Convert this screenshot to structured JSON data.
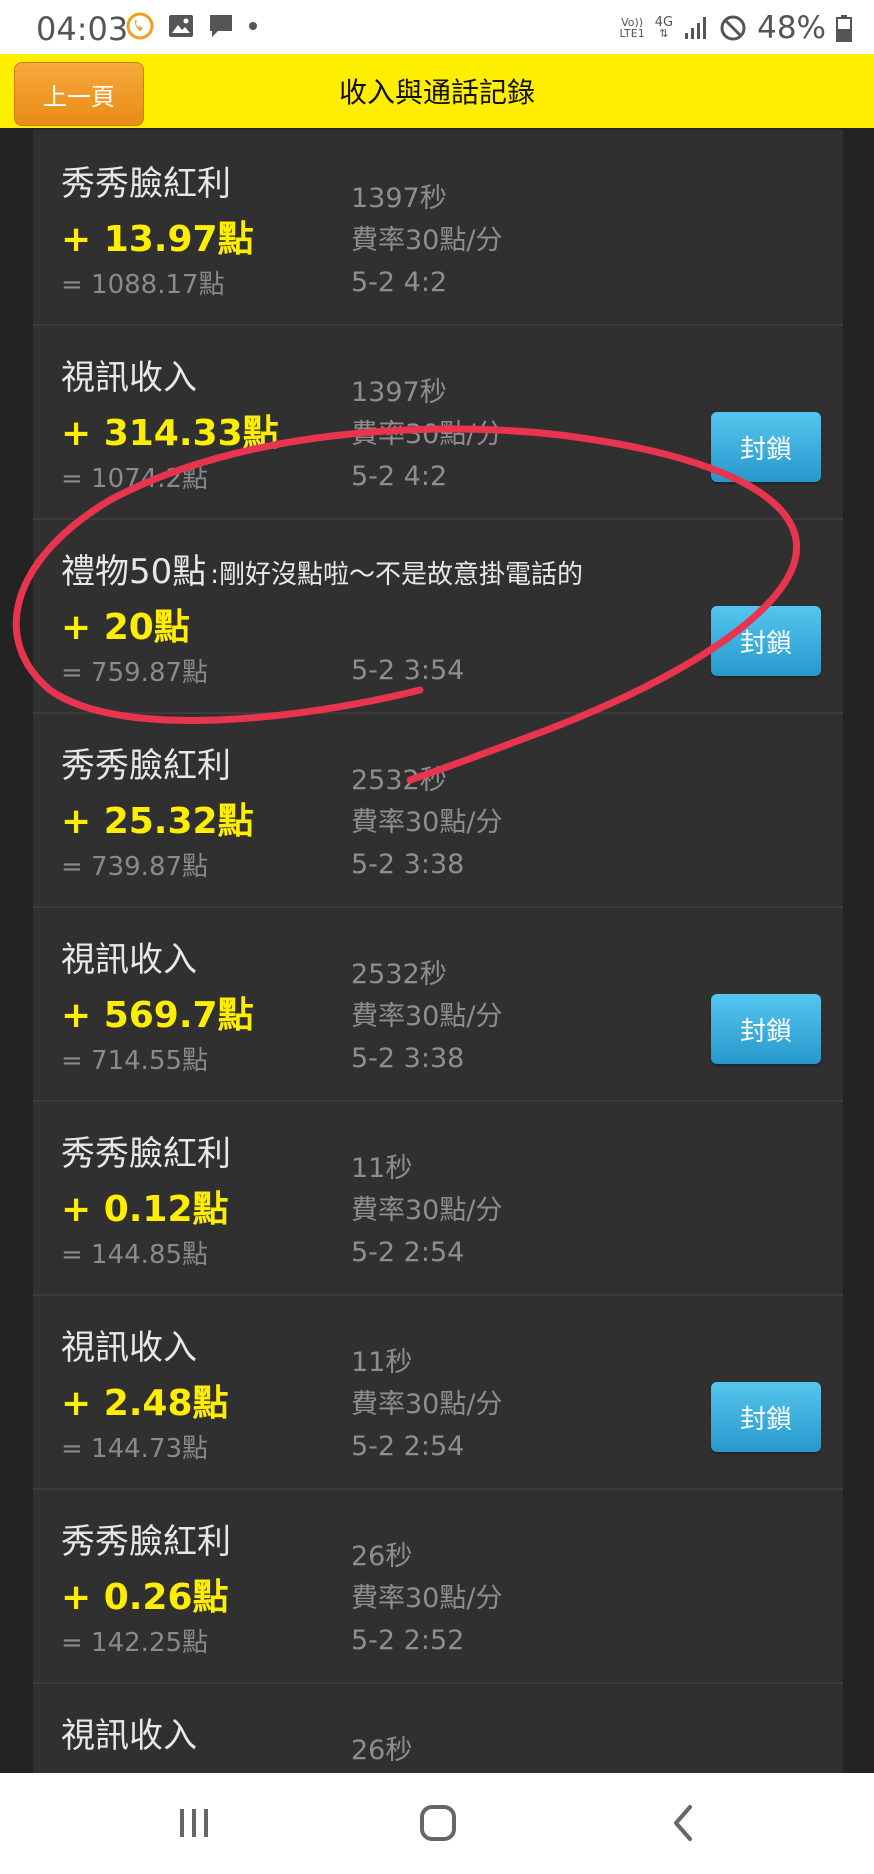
{
  "status_bar": {
    "time": "04:03",
    "left_icons": [
      "phone-call-icon",
      "image-icon",
      "message-icon",
      "dot-icon"
    ],
    "network_label_top": "Vo))",
    "network_label_bottom": "LTE1",
    "network_type": "4G",
    "battery_percent": "48%"
  },
  "header": {
    "back_label": "上一頁",
    "title": "收入與通話記錄",
    "background_color": "#ffee00"
  },
  "records": [
    {
      "title": "秀秀臉紅利",
      "amount": "+ 13.97點",
      "balance": "= 1088.17點",
      "info": [
        "1397秒",
        "費率30點/分",
        "5-2 4:2"
      ],
      "block": false
    },
    {
      "title": "視訊收入",
      "amount": "+ 314.33點",
      "balance": "= 1074.2點",
      "info": [
        "1397秒",
        "費率30點/分",
        "5-2 4:2"
      ],
      "block": true
    },
    {
      "title": "禮物50點",
      "message": ":剛好沒點啦～不是故意掛電話的",
      "amount": "+ 20點",
      "balance": "= 759.87點",
      "info": [
        "",
        "",
        "5-2 3:54"
      ],
      "block": true
    },
    {
      "title": "秀秀臉紅利",
      "amount": "+ 25.32點",
      "balance": "= 739.87點",
      "info": [
        "2532秒",
        "費率30點/分",
        "5-2 3:38"
      ],
      "block": false
    },
    {
      "title": "視訊收入",
      "amount": "+ 569.7點",
      "balance": "= 714.55點",
      "info": [
        "2532秒",
        "費率30點/分",
        "5-2 3:38"
      ],
      "block": true
    },
    {
      "title": "秀秀臉紅利",
      "amount": "+ 0.12點",
      "balance": "= 144.85點",
      "info": [
        "11秒",
        "費率30點/分",
        "5-2 2:54"
      ],
      "block": false
    },
    {
      "title": "視訊收入",
      "amount": "+ 2.48點",
      "balance": "= 144.73點",
      "info": [
        "11秒",
        "費率30點/分",
        "5-2 2:54"
      ],
      "block": true
    },
    {
      "title": "秀秀臉紅利",
      "amount": "+ 0.26點",
      "balance": "= 142.25點",
      "info": [
        "26秒",
        "費率30點/分",
        "5-2 2:52"
      ],
      "block": false
    },
    {
      "title": "視訊收入",
      "amount": "",
      "balance": "",
      "info": [
        "26秒",
        "",
        ""
      ],
      "block": false
    }
  ],
  "block_label": "封鎖",
  "colors": {
    "amount": "#ffee00",
    "block_button": "#2fa6d8",
    "annotation": "#e8344f"
  },
  "nav_bar": {
    "icons": [
      "recent-apps-icon",
      "home-icon",
      "back-icon"
    ]
  }
}
